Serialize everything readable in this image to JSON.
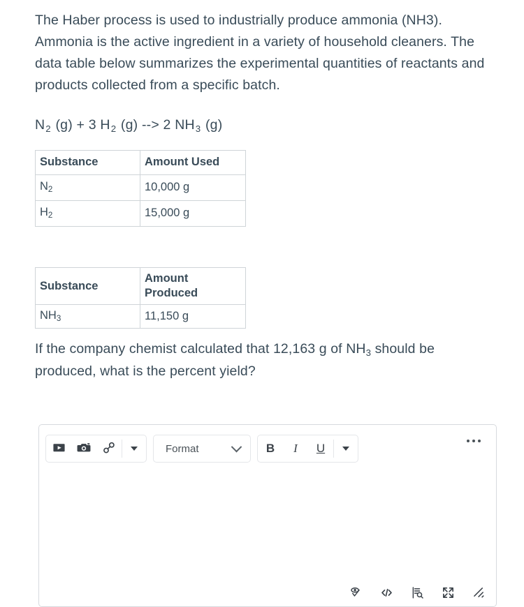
{
  "prompt": {
    "text": "The Haber process is used to industrially produce ammonia (NH3). Ammonia is the active ingredient in a variety of household cleaners. The data table below summarizes the experimental quantities of reactants and products collected from a specific batch."
  },
  "equation": {
    "reactant1": "N",
    "reactant1_sub": "2",
    "reactant1_state": " (g) + 3 H",
    "reactant2_sub": "2",
    "reactant2_state": " (g) --> 2 NH",
    "product_sub": "3",
    "product_state": " (g)",
    "plain": "N2 (g) + 3 H2 (g) --> 2 NH3 (g)"
  },
  "table_reactants": {
    "headers": [
      "Substance",
      "Amount Used"
    ],
    "rows": [
      {
        "substance": "N",
        "substance_sub": "2",
        "amount": "10,000 g"
      },
      {
        "substance": "H",
        "substance_sub": "2",
        "amount": "15,000 g"
      }
    ]
  },
  "table_products": {
    "headers": [
      "Substance",
      "Amount",
      "Produced"
    ],
    "rows": [
      {
        "substance": "NH",
        "substance_sub": "3",
        "amount": "11,150 g"
      }
    ]
  },
  "question": {
    "part1": "If the company chemist calculated that 12,163 g of NH",
    "sub": "3",
    "part2": " should be produced, what is the percent yield?",
    "plain": "If the company chemist calculated that 12,163 g of NH3 should be produced, what is the percent yield?"
  },
  "editor": {
    "toolbar": {
      "media_group": [
        {
          "name": "video-icon",
          "label": "Record/Upload Media"
        },
        {
          "name": "camera-icon",
          "label": "Insert Image"
        },
        {
          "name": "link-icon",
          "label": "Insert Link"
        }
      ],
      "media_caret_label": "More insert options",
      "format_select": {
        "value": "Format",
        "label": "Paragraph format"
      },
      "text_styles": [
        {
          "name": "bold-button",
          "label": "B"
        },
        {
          "name": "italic-button",
          "label": "I"
        },
        {
          "name": "underline-button",
          "label": "U"
        }
      ],
      "text_caret_label": "More text options",
      "overflow_label": "More toolbar options"
    },
    "body": {
      "content": "",
      "placeholder": ""
    },
    "status_icons": [
      {
        "name": "accessibility-checker-icon",
        "label": "Accessibility Checker"
      },
      {
        "name": "html-editor-icon",
        "label": "HTML Editor"
      },
      {
        "name": "word-count-icon",
        "label": "Word Count"
      },
      {
        "name": "fullscreen-icon",
        "label": "Fullscreen"
      },
      {
        "name": "resize-handle-icon",
        "label": "Resize"
      }
    ]
  },
  "colors": {
    "text": "#394b58",
    "table_border": "#cfd4d8",
    "editor_border": "#d7dade",
    "icon": "#3b4249"
  }
}
